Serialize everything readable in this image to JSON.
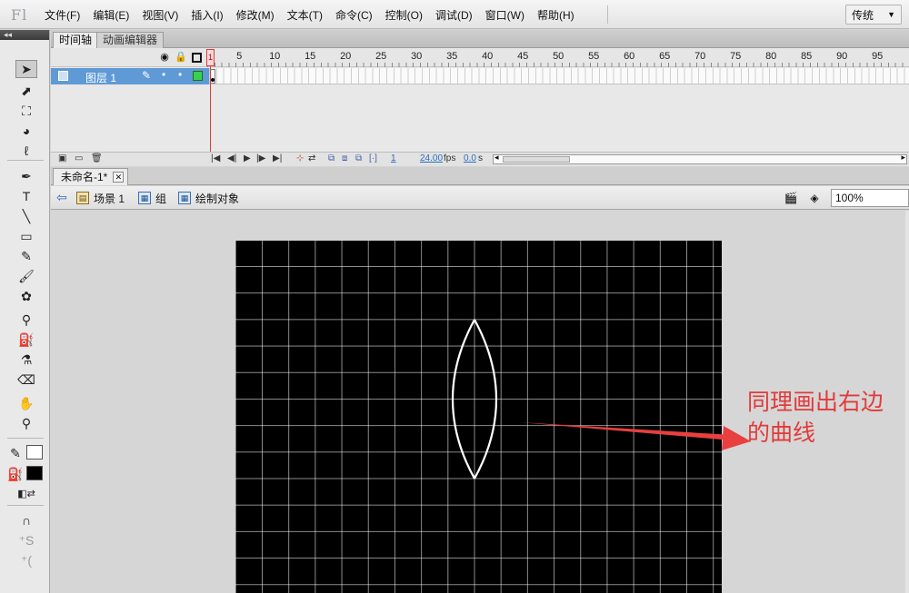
{
  "app": {
    "logo": "Fl"
  },
  "menu": [
    "文件(F)",
    "编辑(E)",
    "视图(V)",
    "插入(I)",
    "修改(M)",
    "文本(T)",
    "命令(C)",
    "控制(O)",
    "调试(D)",
    "窗口(W)",
    "帮助(H)"
  ],
  "workspace": {
    "label": "传统",
    "arrow": "▼"
  },
  "toolbar": {
    "collapse": "◂◂",
    "tools": [
      {
        "name": "selection-tool",
        "glyph": "➤",
        "selected": true
      },
      {
        "name": "subselection-tool",
        "glyph": "⬈"
      },
      {
        "name": "free-transform-tool",
        "glyph": "⛶"
      },
      {
        "name": "3d-rotation-tool",
        "glyph": "◕"
      },
      {
        "name": "lasso-tool",
        "glyph": "ℓ"
      },
      {
        "name": "pen-tool",
        "glyph": "✒"
      },
      {
        "name": "text-tool",
        "glyph": "T"
      },
      {
        "name": "line-tool",
        "glyph": "╲"
      },
      {
        "name": "rectangle-tool",
        "glyph": "▭"
      },
      {
        "name": "pencil-tool",
        "glyph": "✎"
      },
      {
        "name": "brush-tool",
        "glyph": "🖌"
      },
      {
        "name": "deco-tool",
        "glyph": "✿"
      },
      {
        "name": "bone-tool",
        "glyph": "⚲"
      },
      {
        "name": "paint-bucket-tool",
        "glyph": "⛽"
      },
      {
        "name": "eyedropper-tool",
        "glyph": "⚗"
      },
      {
        "name": "eraser-tool",
        "glyph": "⌫"
      },
      {
        "name": "hand-tool",
        "glyph": "✋"
      },
      {
        "name": "zoom-tool",
        "glyph": "⚲"
      }
    ],
    "stroke_color": "#ffffff",
    "fill_color": "#000000"
  },
  "timeline": {
    "tabs": [
      "时间轴",
      "动画编辑器"
    ],
    "layer": {
      "name": "图层 1"
    },
    "ruler": [
      "1",
      "5",
      "10",
      "15",
      "20",
      "25",
      "30",
      "35",
      "40",
      "45",
      "50",
      "55",
      "60",
      "65",
      "70",
      "75",
      "80",
      "85",
      "90",
      "95"
    ],
    "current_frame": "1",
    "fps": "24.00",
    "fps_unit": "fps",
    "time": "0.0",
    "time_unit": "s"
  },
  "document": {
    "tab_title": "未命名-1*",
    "breadcrumbs": [
      "场景 1",
      "组",
      "绘制对象"
    ],
    "zoom": "100%"
  },
  "stage": {
    "background": "#000000",
    "grid_color": "#ffffff",
    "shape_color": "#ffffff"
  },
  "annotation": {
    "line1": "同理画出右边",
    "line2": "的曲线",
    "color": "#e23a3a"
  }
}
